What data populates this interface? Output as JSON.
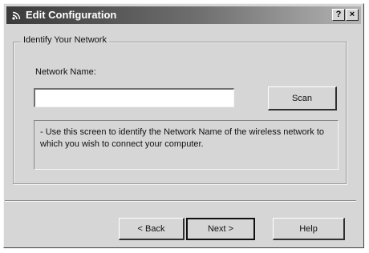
{
  "window": {
    "title": "Edit Configuration",
    "title_icon": "wireless-signal-icon",
    "help_glyph": "?",
    "close_glyph": "×"
  },
  "group": {
    "legend": "Identify Your Network"
  },
  "network_name": {
    "label": "Network Name:",
    "value": "",
    "placeholder": ""
  },
  "buttons": {
    "scan": "Scan",
    "back": "< Back",
    "next": "Next >",
    "help": "Help"
  },
  "info": {
    "bullet": "-",
    "text": "Use this screen to identify the Network Name of the wireless network to which you wish to connect your computer."
  }
}
